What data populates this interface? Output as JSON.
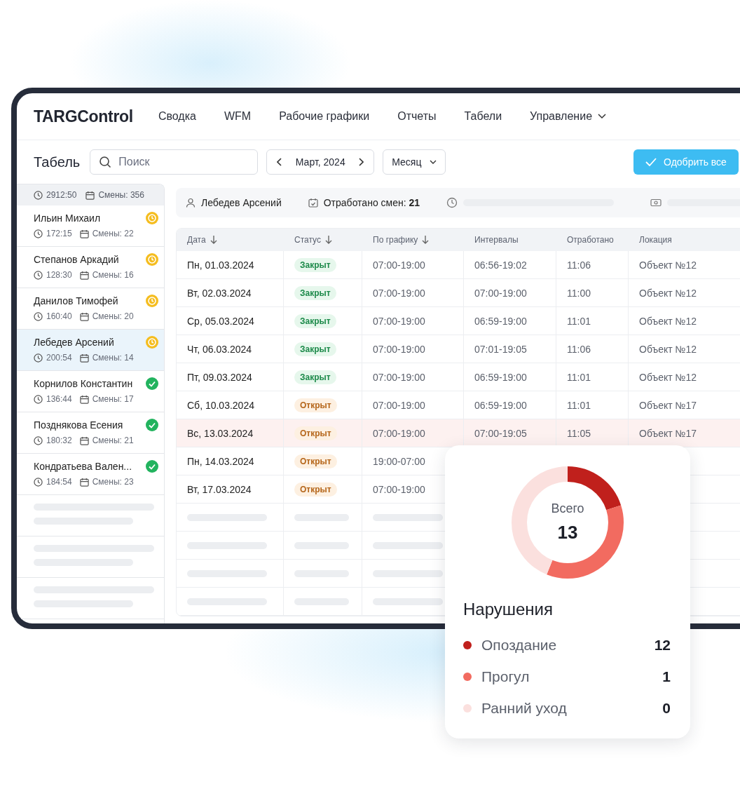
{
  "logo": "TARGControl",
  "nav": [
    {
      "label": "Сводка",
      "dropdown": false
    },
    {
      "label": "WFM",
      "dropdown": false
    },
    {
      "label": "Рабочие графики",
      "dropdown": false
    },
    {
      "label": "Отчеты",
      "dropdown": false
    },
    {
      "label": "Табели",
      "dropdown": false
    },
    {
      "label": "Управление",
      "dropdown": true
    }
  ],
  "toolbar": {
    "title": "Табель",
    "search": {
      "placeholder": "Поиск"
    },
    "period": "Март, 2024",
    "range": "Месяц",
    "approve_button": "Одобрить все"
  },
  "sidebar": {
    "total_hours": "2912:50",
    "total_shifts": "Смены: 356",
    "items": [
      {
        "name": "Ильин Михаил",
        "hours": "172:15",
        "shifts": "Смены: 22",
        "kind": "pending",
        "selected": false
      },
      {
        "name": "Степанов Аркадий",
        "hours": "128:30",
        "shifts": "Смены: 16",
        "kind": "pending",
        "selected": false
      },
      {
        "name": "Данилов Тимофей",
        "hours": "160:40",
        "shifts": "Смены: 20",
        "kind": "pending",
        "selected": false
      },
      {
        "name": "Лебедев Арсений",
        "hours": "200:54",
        "shifts": "Смены: 14",
        "kind": "pending",
        "selected": true
      },
      {
        "name": "Корнилов Константин",
        "hours": "136:44",
        "shifts": "Смены: 17",
        "kind": "approved",
        "selected": false
      },
      {
        "name": "Позднякова Есения",
        "hours": "180:32",
        "shifts": "Смены: 21",
        "kind": "approved",
        "selected": false
      },
      {
        "name": "Кондратьева Вален...",
        "hours": "184:54",
        "shifts": "Смены: 23",
        "kind": "approved",
        "selected": false
      }
    ]
  },
  "summary": {
    "employee": "Лебедев Арсений",
    "shifts_worked": "Отработано смен: **21**"
  },
  "table": {
    "columns": [
      {
        "label": "Дата",
        "sortable": true
      },
      {
        "label": "Статус",
        "sortable": true
      },
      {
        "label": "По графику",
        "sortable": true
      },
      {
        "label": "Интервалы",
        "sortable": false
      },
      {
        "label": "Отработано",
        "sortable": false
      },
      {
        "label": "Локация",
        "sortable": false
      }
    ],
    "rows": [
      {
        "date": "Пн, 01.03.2024",
        "status": "Закрыт",
        "kind": "closed",
        "schedule": "07:00-19:00",
        "intervals": "06:56-19:02",
        "worked": "11:06",
        "location": "Объект №12",
        "highlighted": false
      },
      {
        "date": "Вт, 02.03.2024",
        "status": "Закрыт",
        "kind": "closed",
        "schedule": "07:00-19:00",
        "intervals": "07:00-19:00",
        "worked": "11:00",
        "location": "Объект №12",
        "highlighted": false
      },
      {
        "date": "Ср, 05.03.2024",
        "status": "Закрыт",
        "kind": "closed",
        "schedule": "07:00-19:00",
        "intervals": "06:59-19:00",
        "worked": "11:01",
        "location": "Объект №12",
        "highlighted": false
      },
      {
        "date": "Чт, 06.03.2024",
        "status": "Закрыт",
        "kind": "closed",
        "schedule": "07:00-19:00",
        "intervals": "07:01-19:05",
        "worked": "11:06",
        "location": "Объект №12",
        "highlighted": false
      },
      {
        "date": "Пт, 09.03.2024",
        "status": "Закрыт",
        "kind": "closed",
        "schedule": "07:00-19:00",
        "intervals": "06:59-19:00",
        "worked": "11:01",
        "location": "Объект №12",
        "highlighted": false
      },
      {
        "date": "Сб, 10.03.2024",
        "status": "Открыт",
        "kind": "open",
        "schedule": "07:00-19:00",
        "intervals": "06:59-19:00",
        "worked": "11:01",
        "location": "Объект №17",
        "highlighted": false
      },
      {
        "date": "Вс, 13.03.2024",
        "status": "Открыт",
        "kind": "open",
        "schedule": "07:00-19:00",
        "intervals": "07:00-19:05",
        "worked": "11:05",
        "location": "Объект №17",
        "highlighted": true
      },
      {
        "date": "Пн, 14.03.2024",
        "status": "Открыт",
        "kind": "open",
        "schedule": "19:00-07:00",
        "highlighted": false
      },
      {
        "date": "Вт, 17.03.2024",
        "status": "Открыт",
        "kind": "open",
        "schedule": "07:00-19:00",
        "highlighted": false
      }
    ]
  },
  "violations": {
    "total_label": "Всего",
    "total": "13",
    "title": "Нарушения",
    "items": [
      {
        "label": "Опоздание",
        "count": "12",
        "color": "#c0201c"
      },
      {
        "label": "Прогул",
        "count": "1",
        "color": "#f26b60"
      },
      {
        "label": "Ранний уход",
        "count": "0",
        "color": "#fbe0de"
      }
    ]
  }
}
